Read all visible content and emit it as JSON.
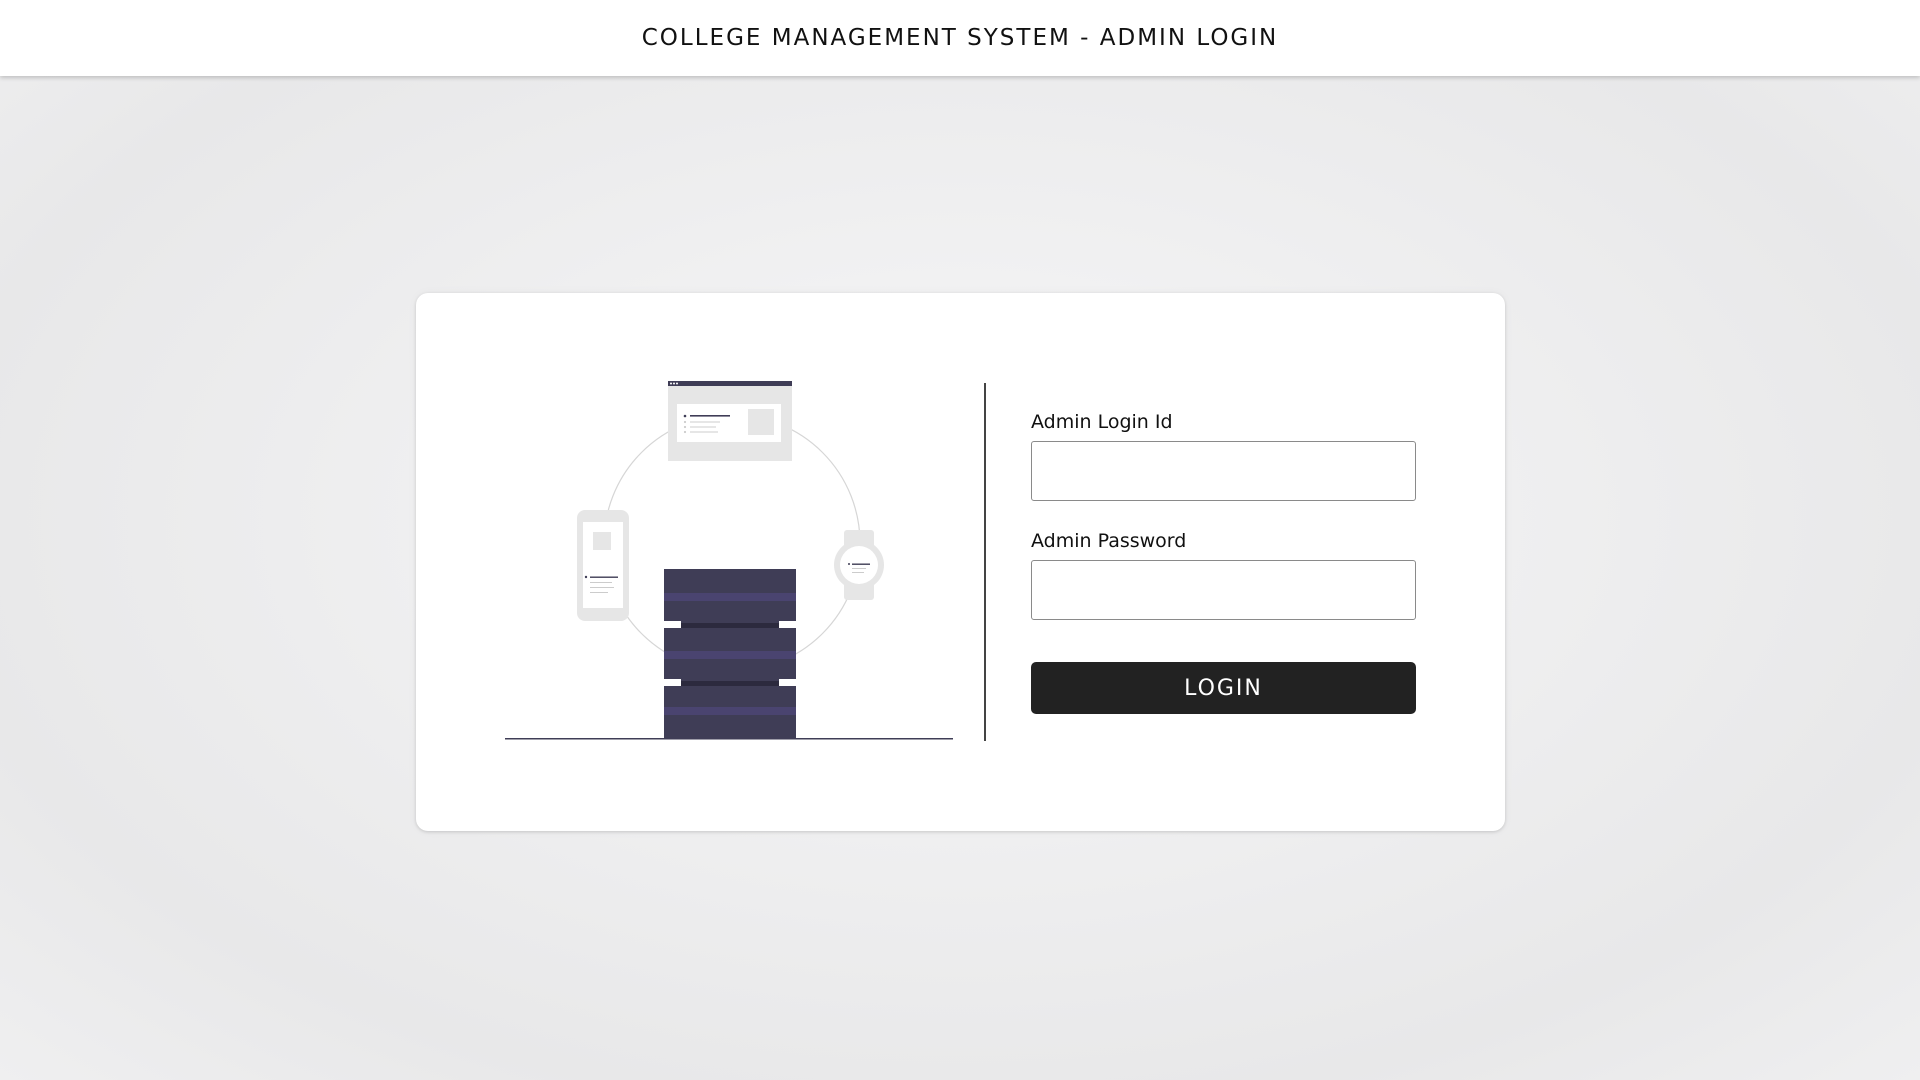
{
  "header": {
    "title": "COLLEGE MANAGEMENT SYSTEM - ADMIN LOGIN"
  },
  "login_form": {
    "login_id_label": "Admin Login Id",
    "login_id_value": "",
    "password_label": "Admin Password",
    "password_value": "",
    "submit_label": "LOGIN"
  },
  "illustration": {
    "icon": "server-devices-illustration",
    "accent_color": "#3f3d56",
    "highlight_color": "#4a4470",
    "light_color": "#e6e6e6"
  },
  "colors": {
    "button_background": "#222222",
    "card_background": "#ffffff"
  }
}
